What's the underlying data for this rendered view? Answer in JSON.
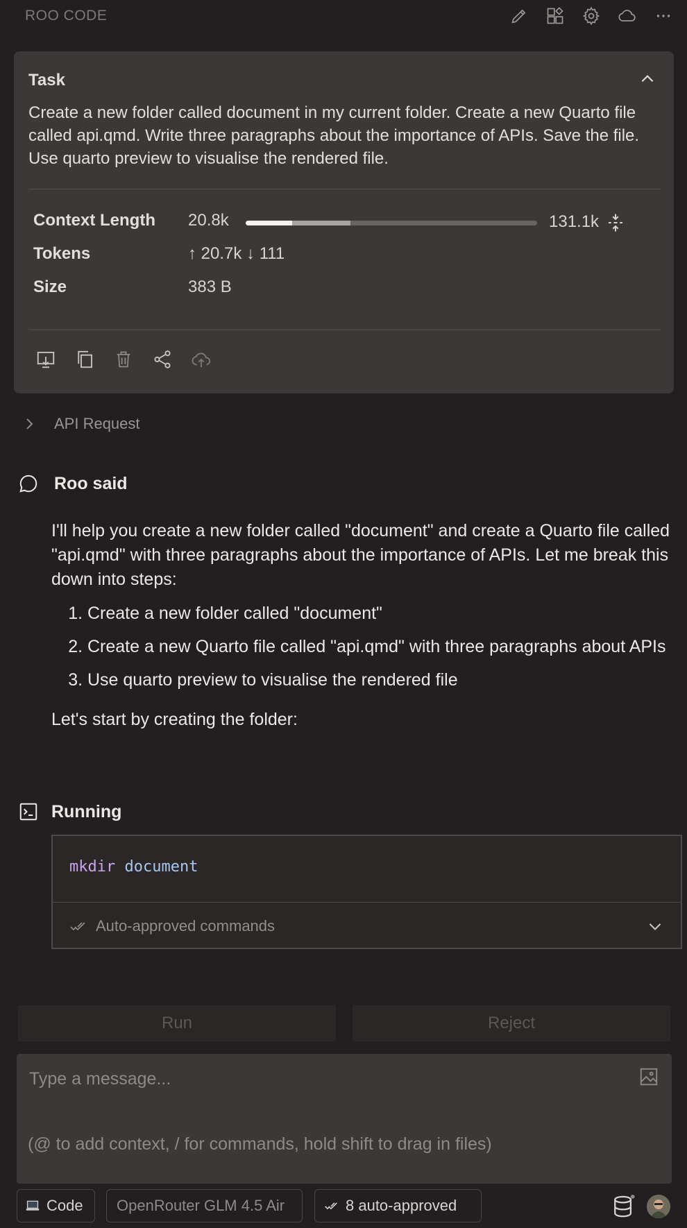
{
  "header": {
    "title": "ROO CODE",
    "icons": [
      "edit-icon",
      "marketplace-icon",
      "gear-icon",
      "cloud-icon",
      "more-icon"
    ]
  },
  "task": {
    "title": "Task",
    "text": "Create a new folder called document in my current folder. Create a new Quarto file called api.qmd. Write three paragraphs about the importance of APIs. Save the file. Use quarto preview to visualise the rendered file.",
    "context_length_label": "Context Length",
    "context_length_value": "20.8k",
    "context_max": "131.1k",
    "context_used_fraction": 0.159,
    "context_reserved_fraction": 0.2,
    "tokens_label": "Tokens",
    "tokens_value": "↑ 20.7k ↓ 111",
    "size_label": "Size",
    "size_value": "383 B"
  },
  "api_request": {
    "label": "API Request"
  },
  "roo": {
    "label": "Roo said",
    "intro": "I'll help you create a new folder called \"document\" and create a Quarto file called \"api.qmd\" with three paragraphs about the importance of APIs. Let me break this down into steps:",
    "steps": [
      "Create a new folder called \"document\"",
      "Create a new Quarto file called \"api.qmd\" with three paragraphs about APIs",
      "Use quarto preview to visualise the rendered file"
    ],
    "outro": "Let's start by creating the folder:"
  },
  "running": {
    "label": "Running",
    "command_name": "mkdir",
    "command_arg": "document",
    "auto_label": "Auto-approved commands"
  },
  "actions": {
    "run": "Run",
    "reject": "Reject"
  },
  "input": {
    "placeholder": "Type a message...",
    "hint": "(@ to add context, / for commands, hold shift to drag in files)"
  },
  "bottom": {
    "mode": "Code",
    "model": "OpenRouter GLM 4.5 Air",
    "auto_approved": "8 auto-approved"
  },
  "colors": {
    "background": "#231f20",
    "card": "#3d3838",
    "command_keyword": "#c9a5f0",
    "command_arg": "#a7c7f2"
  }
}
